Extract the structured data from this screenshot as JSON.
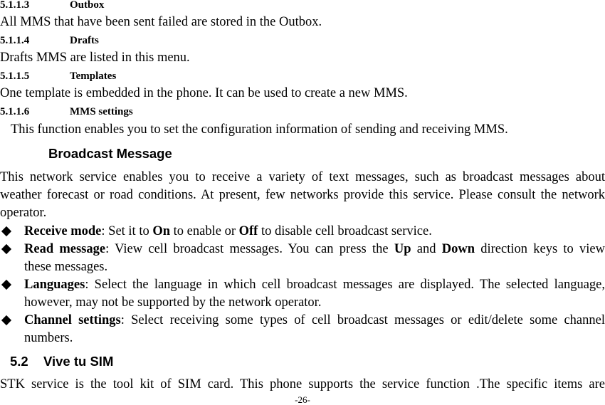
{
  "sections": {
    "outbox": {
      "number": "5.1.1.3",
      "title": "Outbox",
      "text": "All MMS that have been sent failed are stored in the Outbox."
    },
    "drafts": {
      "number": "5.1.1.4",
      "title": "Drafts",
      "text": "Drafts MMS are listed in this menu."
    },
    "templates": {
      "number": "5.1.1.5",
      "title": "Templates",
      "text": "One template is embedded in the phone. It can be used to create a new MMS."
    },
    "mms_settings": {
      "number": "5.1.1.6",
      "title": "MMS settings",
      "text": "This function enables you to set the configuration information of sending and receiving MMS."
    }
  },
  "broadcast": {
    "heading": "Broadcast Message",
    "intro_lines": [
      "This network service enables you to receive a variety of text messages, such as broadcast messages about",
      "weather forecast or road conditions. At present, few networks provide this service. Please consult the network",
      "operator."
    ],
    "items": [
      {
        "term": "Receive mode",
        "parts": [
          ": Set it to ",
          "On",
          " to enable or ",
          "Off",
          " to disable cell broadcast service."
        ]
      },
      {
        "term": "Read message",
        "line1_parts": [
          ": View cell broadcast messages. You can press the ",
          "Up",
          " and ",
          "Down",
          " direction keys to view"
        ],
        "line2": "these messages."
      },
      {
        "term": "Languages",
        "line1": ": Select the language in which cell broadcast messages are displayed. The selected language,",
        "line2": "however, may not be supported by the network operator."
      },
      {
        "term": "Channel settings",
        "line1": ": Select receiving some types of cell broadcast messages or edit/delete some channel",
        "line2": "numbers."
      }
    ]
  },
  "vive_sim": {
    "number": "5.2",
    "title": "Vive tu SIM",
    "text_line": "STK service is the tool kit of SIM card. This phone supports the service function .The specific items are"
  },
  "footer": {
    "page_number": "-26-"
  }
}
